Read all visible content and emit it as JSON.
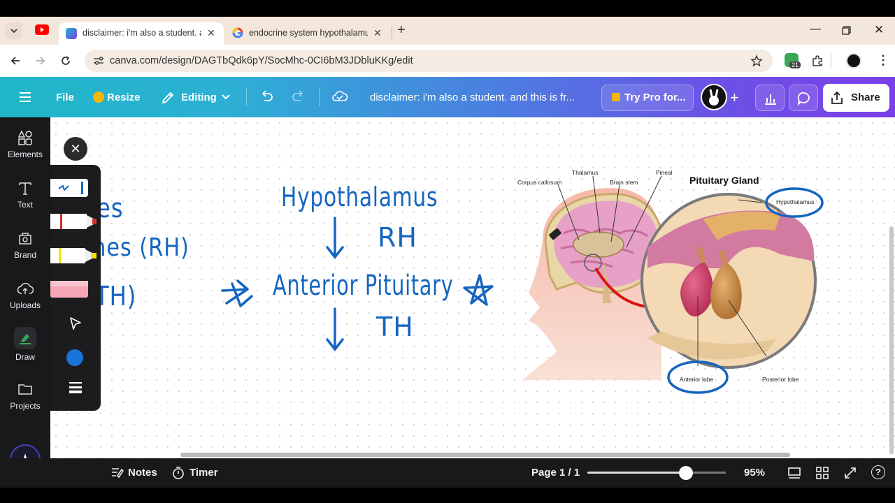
{
  "browser": {
    "tabs": [
      {
        "title": "disclaimer: i'm also a student. a",
        "active": true
      },
      {
        "title": "endocrine system hypothalamu",
        "active": false
      }
    ],
    "new_tab": "+",
    "url": "canva.com/design/DAGTbQdk6pY/SocMhc-0CI6bM3JDbluKKg/edit",
    "extension_badge": "21"
  },
  "header": {
    "file": "File",
    "resize": "Resize",
    "editing": "Editing",
    "doc_title": "disclaimer: i'm also a student. and this is fr...",
    "try_pro": "Try Pro for...",
    "share": "Share"
  },
  "sidebar": {
    "items": [
      {
        "label": "Elements",
        "icon": "elements-icon"
      },
      {
        "label": "Text",
        "icon": "text-icon"
      },
      {
        "label": "Brand",
        "icon": "brand-icon"
      },
      {
        "label": "Uploads",
        "icon": "uploads-icon"
      },
      {
        "label": "Draw",
        "icon": "draw-icon"
      },
      {
        "label": "Projects",
        "icon": "projects-icon"
      }
    ]
  },
  "draw_panel": {
    "tools": [
      "pen",
      "marker",
      "highlighter",
      "eraser",
      "select"
    ],
    "current_color": "#1a73d9"
  },
  "canvas_text": {
    "partial_line1": "es",
    "partial_line2": "nes (RH)",
    "partial_line3": "TH)",
    "hypothalamus": "Hypothalamus",
    "rh": "RH",
    "anterior": "Anterior Pituitary",
    "th": "TH"
  },
  "diagram": {
    "title": "Pituitary Gland",
    "labels": {
      "corpus": "Corpus callosum",
      "thalamus": "Thalamus",
      "brainstem": "Brain stem",
      "pineal": "Pineal",
      "hypothalamus": "Hypothalamus",
      "anterior": "Anterior lobe",
      "posterior": "Posterior lobe"
    }
  },
  "footer": {
    "notes": "Notes",
    "timer": "Timer",
    "page": "Page 1 / 1",
    "zoom_value": 0.71,
    "zoom": "95%"
  },
  "colors": {
    "ink": "#1565c0",
    "header_start": "#1fb6c8",
    "header_end": "#7b3fe8"
  }
}
